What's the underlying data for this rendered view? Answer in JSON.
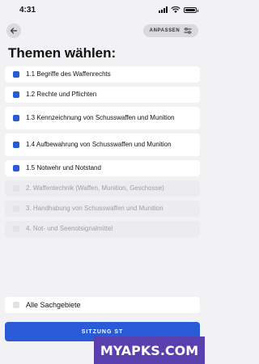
{
  "status": {
    "time": "4:31"
  },
  "header": {
    "adjust_label": "ANPASSEN"
  },
  "title": "Themen wählen:",
  "topics": [
    {
      "label": "1.1 Begriffe des Waffenrechts",
      "checked": true
    },
    {
      "label": "1.2 Rechte und Pflichten",
      "checked": true
    },
    {
      "label": "1.3 Kennzeichnung von Schusswaffen und Munition",
      "checked": true
    },
    {
      "label": "1.4 Aufbewahrung von Schusswaffen und Munition",
      "checked": true
    },
    {
      "label": "1.5 Notwehr und Notstand",
      "checked": true
    },
    {
      "label": "2. Waffentechnik (Waffen, Munition, Geschosse)",
      "checked": false
    },
    {
      "label": "3. Handhabung von Schusswaffen und Munition",
      "checked": false
    },
    {
      "label": "4. Not- und Seenotsignalmittel",
      "checked": false
    }
  ],
  "all_topics": {
    "label": "Alle Sachgebiete",
    "checked": false
  },
  "start_button": {
    "label": "SITZUNG ST"
  },
  "watermark": "MYAPKS.COM",
  "colors": {
    "accent": "#2a5bd6",
    "background": "#f2f2f4"
  }
}
